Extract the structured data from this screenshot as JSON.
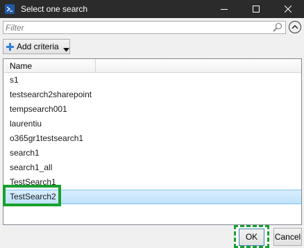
{
  "window": {
    "title": "Select one search",
    "icon": "powershell-icon",
    "controls": [
      "minimize-icon",
      "maximize-icon",
      "close-icon"
    ]
  },
  "filter": {
    "placeholder": "Filter",
    "value": ""
  },
  "toolbar": {
    "add_criteria_label": "Add criteria"
  },
  "list": {
    "columns": [
      "Name"
    ],
    "items": [
      "s1",
      "testsearch2sharepoint",
      "tempsearch001",
      "laurentiu",
      "o365gr1testsearch1",
      "search1",
      "search1_all",
      "TestSearch1",
      "TestSearch2"
    ],
    "selected_index": 8
  },
  "buttons": {
    "ok_label": "OK",
    "cancel_label": "Cancel"
  },
  "colors": {
    "titlebar": "#2b2b2b",
    "selection": "#cce8ff",
    "highlight": "#18a12f"
  }
}
